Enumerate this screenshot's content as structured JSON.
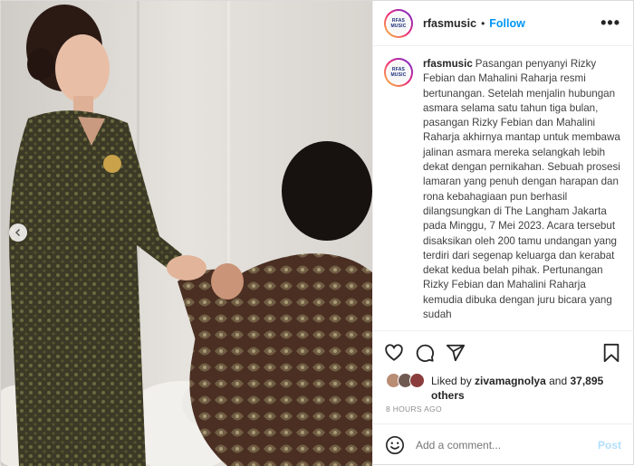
{
  "post": {
    "account": {
      "username": "rfasmusic",
      "avatar_text_line1": "RFAS",
      "avatar_text_line2": "MUSIC",
      "separator": "•",
      "follow_label": "Follow",
      "more_label": "•••"
    },
    "caption": {
      "username": "rfasmusic",
      "text": "Pasangan penyanyi Rizky Febian dan Mahalini Raharja resmi bertunangan. Setelah menjalin hubungan asmara selama satu tahun tiga bulan, pasangan Rizky Febian dan Mahalini Raharja akhirnya mantap untuk membawa jalinan asmara mereka selangkah lebih dekat dengan pernikahan. Sebuah prosesi lamaran yang penuh dengan harapan dan rona kebahagiaan pun berhasil dilangsungkan di The Langham Jakarta pada Minggu, 7 Mei 2023. Acara tersebut disaksikan oleh 200 tamu undangan yang terdiri dari segenap keluarga dan kerabat dekat kedua belah pihak. Pertunangan Rizky Febian dan Mahalini Raharja kemudia dibuka dengan juru bicara yang sudah"
    },
    "icons": {
      "like": "heart-icon",
      "comment": "comment-icon",
      "share": "share-icon",
      "save": "bookmark-icon",
      "prev": "chevron-left-icon",
      "emoji": "emoji-icon"
    },
    "likes": {
      "prefix": "Liked by",
      "user": "zivamagnolya",
      "conjunction": "and",
      "count": "37,895",
      "suffix": "others"
    },
    "timestamp": "8 HOURS AGO",
    "comment": {
      "placeholder": "Add a comment...",
      "post_label": "Post"
    },
    "colors": {
      "accent": "#0095f6",
      "post_disabled": "#b2dffc",
      "muted": "#8e8e8e"
    }
  }
}
